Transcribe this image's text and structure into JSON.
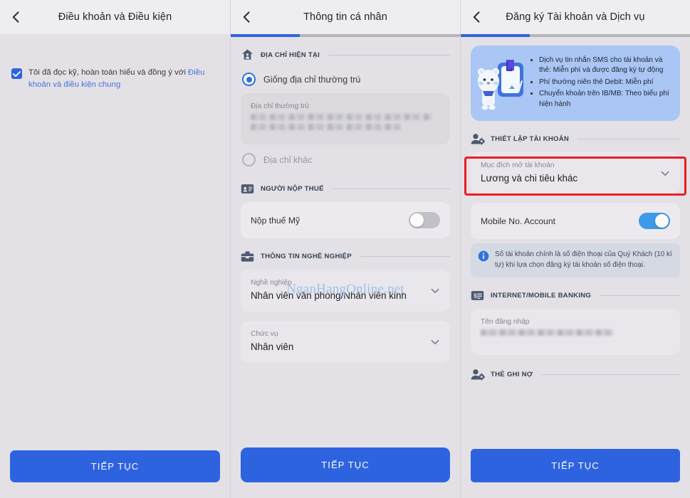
{
  "colors": {
    "accent_blue": "#2e63e0",
    "toggle_on": "#3d9ae8",
    "highlight_red": "#ec1c24",
    "promo_bg": "#a9c6f5",
    "screen_bg": "#e3e1e6"
  },
  "watermark": "NganHangOnline.net",
  "panel1": {
    "header": {
      "title": "Điều khoản và Điều kiện",
      "back_icon": "chevron-left-icon"
    },
    "consent": {
      "checked": true,
      "text_before": "Tôi đã đọc kỹ, hoàn toàn hiểu và đồng ý với ",
      "link_text": "Điều khoản và điều kiện chung"
    },
    "cta": "TIẾP TỤC"
  },
  "panel2": {
    "header": {
      "title": "Thông tin cá nhân",
      "back_icon": "chevron-left-icon"
    },
    "progress_percent": 30,
    "sections": [
      {
        "icon": "home-address-icon",
        "label": "ĐỊA CHỈ HIỆN TẠI"
      },
      {
        "icon": "id-card-icon",
        "label": "NGƯỜI NỘP THUẾ"
      },
      {
        "icon": "briefcase-icon",
        "label": "THÔNG TIN NGHỀ NGHIỆP"
      }
    ],
    "radio_same_address": {
      "label": "Giống địa chỉ thường trú",
      "selected": true
    },
    "radio_other_address": {
      "label": "Địa chỉ khác",
      "selected": false
    },
    "address_card": {
      "label": "Địa chỉ thường trú",
      "value_redacted": true
    },
    "tax_toggle": {
      "label": "Nộp thuế Mỹ",
      "on": false
    },
    "occupation_card": {
      "label": "Nghề nghiệp",
      "value": "Nhân viên văn phòng/Nhân viên kinh",
      "chevron": "chevron-down-icon"
    },
    "position_card": {
      "label": "Chức vụ",
      "value": "Nhân viên",
      "chevron": "chevron-down-icon"
    },
    "cta": "TIẾP TỤC"
  },
  "panel3": {
    "header": {
      "title": "Đăng ký Tài khoản và Dịch vụ",
      "back_icon": "chevron-left-icon"
    },
    "progress_percent": 30,
    "promo": {
      "mascot_icon": "bear-mascot-icon",
      "bullets": [
        "Dịch vụ tin nhắn SMS cho tài khoản và thẻ: Miễn phí và được đăng ký tự động",
        "Phí thường niên thẻ Debit: Miễn phí",
        "Chuyển khoản trên IB/MB: Theo biểu phí hiện hành"
      ]
    },
    "sections": [
      {
        "icon": "account-settings-icon",
        "label": "THIẾT LẬP TÀI KHOẢN"
      },
      {
        "icon": "banking-card-icon",
        "label": "INTERNET/MOBILE BANKING"
      },
      {
        "icon": "account-settings-icon",
        "label": "THẺ GHI NỢ"
      }
    ],
    "purpose_card": {
      "label": "Mục đích mở tài khoản",
      "value": "Lương và chi tiêu khác",
      "chevron": "chevron-down-icon"
    },
    "mobile_account_toggle": {
      "label": "Mobile No. Account",
      "on": true,
      "highlighted": true
    },
    "info_note": {
      "icon": "info-icon",
      "text": "Số tài khoản chính là số điện thoại của Quý Khách (10 kí tự) khi lựa chọn đăng ký tài khoản số điện thoại."
    },
    "username_card": {
      "label": "Tên đăng nhập",
      "value_redacted": true
    },
    "cta": "TIẾP TỤC"
  }
}
